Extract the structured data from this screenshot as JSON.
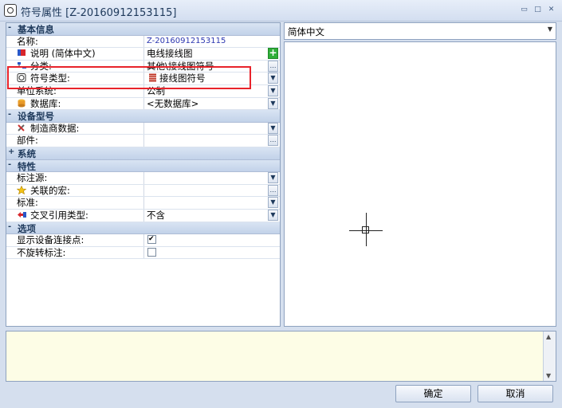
{
  "window": {
    "title": "符号属性 [Z-20160912153115]",
    "controls": [
      "▭",
      "□",
      "✕"
    ]
  },
  "grid": {
    "rows": [
      {
        "type": "cat",
        "toggle": "-",
        "label": "基本信息"
      },
      {
        "type": "prop",
        "name": "名称:",
        "value": "Z-20160912153115",
        "value_style": "blue"
      },
      {
        "type": "prop",
        "icon": "flag-icon",
        "name": "说明 (简体中文)",
        "value": "电线接线图",
        "button": "plus"
      },
      {
        "type": "prop",
        "icon": "category-icon",
        "name": "分类:",
        "value": "其他\\接线图符号",
        "button": "ellipsis"
      },
      {
        "type": "prop",
        "icon": "symbol-type-icon",
        "name": "符号类型:",
        "value": "接线图符号",
        "value_icon": true,
        "button": "dropdown"
      },
      {
        "type": "prop",
        "name": "单位系统:",
        "value": "公制",
        "button": "dropdown"
      },
      {
        "type": "prop",
        "icon": "database-icon",
        "name": "数据库:",
        "value": "<无数据库>",
        "button": "dropdown"
      },
      {
        "type": "cat",
        "toggle": "-",
        "label": "设备型号"
      },
      {
        "type": "prop",
        "icon": "tools-icon",
        "name": "制造商数据:",
        "value": "",
        "button": "dropdown"
      },
      {
        "type": "prop",
        "name": "部件:",
        "value": "",
        "button": "ellipsis"
      },
      {
        "type": "cat",
        "toggle": "+",
        "label": "系统"
      },
      {
        "type": "cat",
        "toggle": "-",
        "label": "特性"
      },
      {
        "type": "prop",
        "name": "标注源:",
        "value": "",
        "button": "dropdown"
      },
      {
        "type": "prop",
        "icon": "star-icon",
        "name": "关联的宏:",
        "value": "",
        "button": "ellipsis"
      },
      {
        "type": "prop",
        "name": "标准:",
        "value": "",
        "button": "dropdown"
      },
      {
        "type": "prop",
        "icon": "crossref-icon",
        "name": "交叉引用类型:",
        "value": "不含",
        "button": "dropdown"
      },
      {
        "type": "cat",
        "toggle": "-",
        "label": "选项"
      },
      {
        "type": "prop",
        "name": "显示设备连接点:",
        "checkbox": true,
        "checked": true
      },
      {
        "type": "prop",
        "name": "不旋转标注:",
        "checkbox": true,
        "checked": false
      }
    ]
  },
  "language": {
    "selected": "简体中文"
  },
  "footer": {
    "ok_label": "确定",
    "cancel_label": "取消"
  },
  "colors": {
    "accent": "#e8232b",
    "value_blue": "#2b36b0"
  }
}
